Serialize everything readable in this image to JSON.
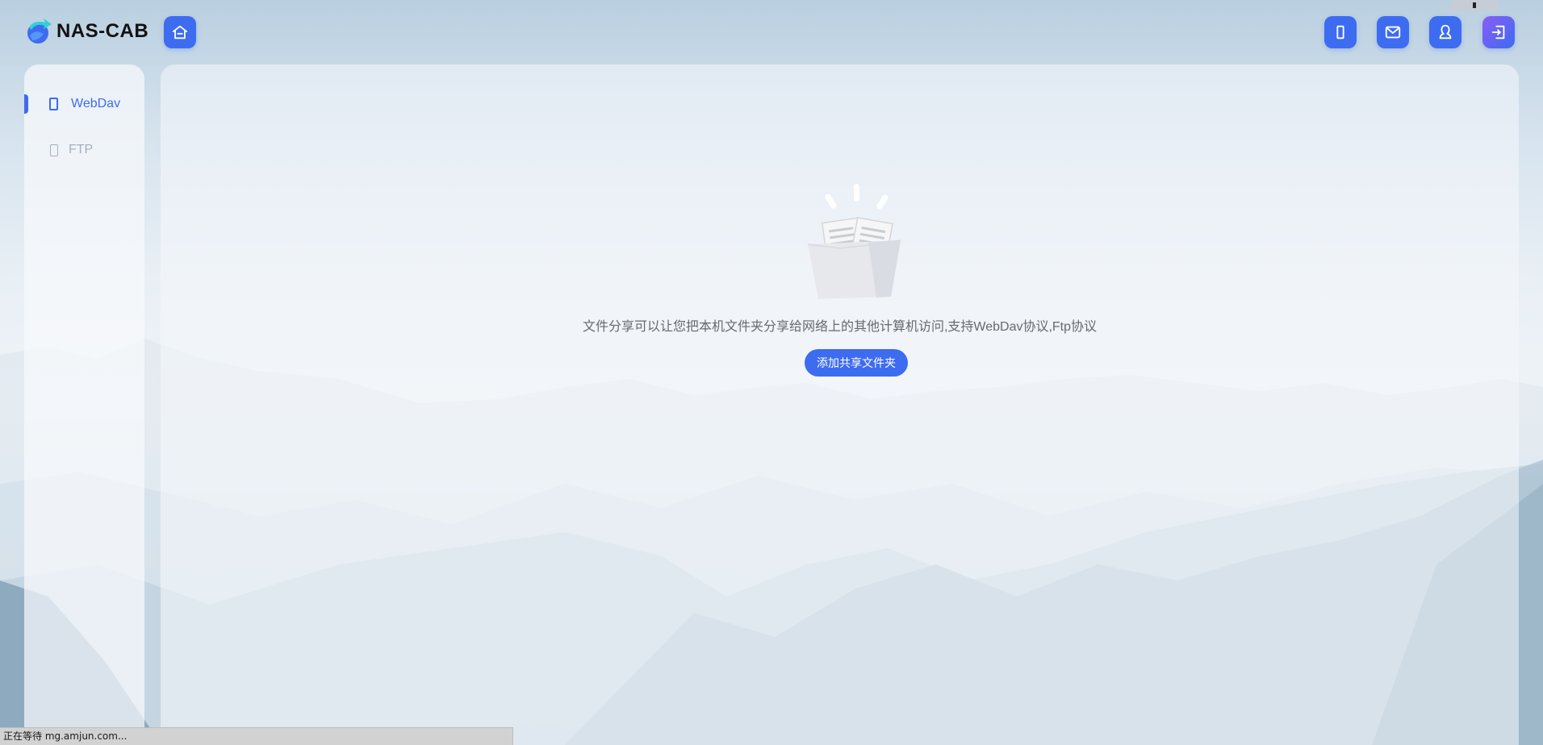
{
  "app": {
    "logo_text": "NAS-CAB"
  },
  "header": {
    "icons": {
      "home": "home-icon",
      "phone": "phone-icon",
      "mail": "mail-icon",
      "user": "user-icon",
      "logout": "logout-icon"
    }
  },
  "sidebar": {
    "items": [
      {
        "label": "WebDav",
        "icon": "device-icon",
        "active": true
      },
      {
        "label": "FTP",
        "icon": "device-icon",
        "active": false
      }
    ]
  },
  "main": {
    "empty_message": "文件分享可以让您把本机文件夹分享给网络上的其他计算机访问,支持WebDav协议,Ftp协议",
    "add_button_label": "添加共享文件夹"
  },
  "status_bar": {
    "text": "正在等待 mg.amjun.com..."
  },
  "colors": {
    "accent": "#3d6cf0",
    "inactive": "#a7b0bc"
  }
}
